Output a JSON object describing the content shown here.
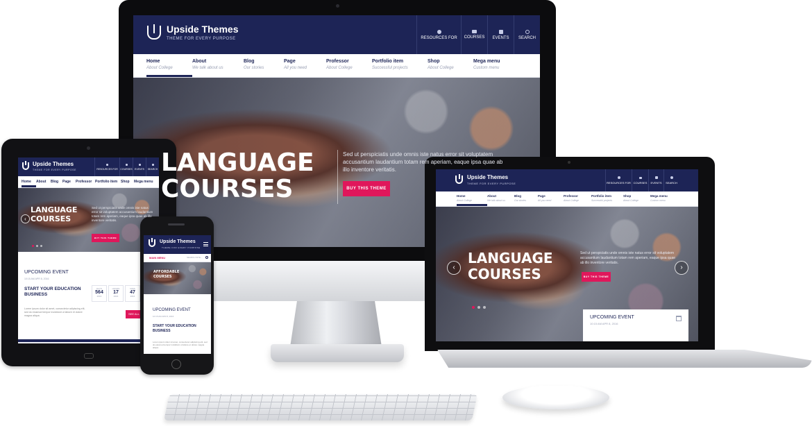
{
  "site": {
    "brand": "Upside Themes",
    "tagline": "THEME FOR EVERY PURPOSE",
    "quick_links": [
      {
        "label": "RESOURCES FOR",
        "icon": "person-icon"
      },
      {
        "label": "COURSES",
        "icon": "list-icon"
      },
      {
        "label": "EVENTS",
        "icon": "calendar-icon"
      },
      {
        "label": "SEARCH",
        "icon": "search-icon"
      }
    ],
    "nav": [
      {
        "title": "Home",
        "sub": "About College"
      },
      {
        "title": "About",
        "sub": "We talk about us"
      },
      {
        "title": "Blog",
        "sub": "Our stories"
      },
      {
        "title": "Page",
        "sub": "All you need"
      },
      {
        "title": "Professor",
        "sub": "About College"
      },
      {
        "title": "Portfolio item",
        "sub": "Successful projects"
      },
      {
        "title": "Shop",
        "sub": "About College"
      },
      {
        "title": "Mega menu",
        "sub": "Custom menu"
      }
    ],
    "hero": {
      "title_line1": "LANGUAGE",
      "title_line2": "COURSES",
      "desc": "Sed ut perspiciatis unde omnis iste natus error sit voluptatem accusantium laudantium totam rem aperiam, eaque ipsa quae ab illo inventore veritatis.",
      "button": "BUY THIS THEME"
    },
    "upcoming": {
      "heading": "UPCOMING EVENT",
      "meta": "10:15 AM  APR 8, 2016",
      "event_title": "START YOUR EDUCATION BUSINESS",
      "countdown": [
        {
          "label": "DAYS",
          "value": "564",
          "unit": "2016"
        },
        {
          "label": "HOURS",
          "value": "17",
          "unit": "2016"
        },
        {
          "label": "MINS",
          "value": "47",
          "unit": "2016"
        }
      ],
      "text": "Lorem ipsum dolor sit amet, consectetur adipiscing elit, sed do eiusmod tempor incididunt ut labore et dolore magna aliqua.",
      "see_all": "SEE ALL"
    },
    "mobile": {
      "main_menu": "MAIN MENU",
      "search_placeholder": "SEARCH SITE...",
      "hero_title": "AFFORDABLE COURSES"
    }
  },
  "colors": {
    "navy": "#1d2456",
    "accent": "#e0175b"
  }
}
